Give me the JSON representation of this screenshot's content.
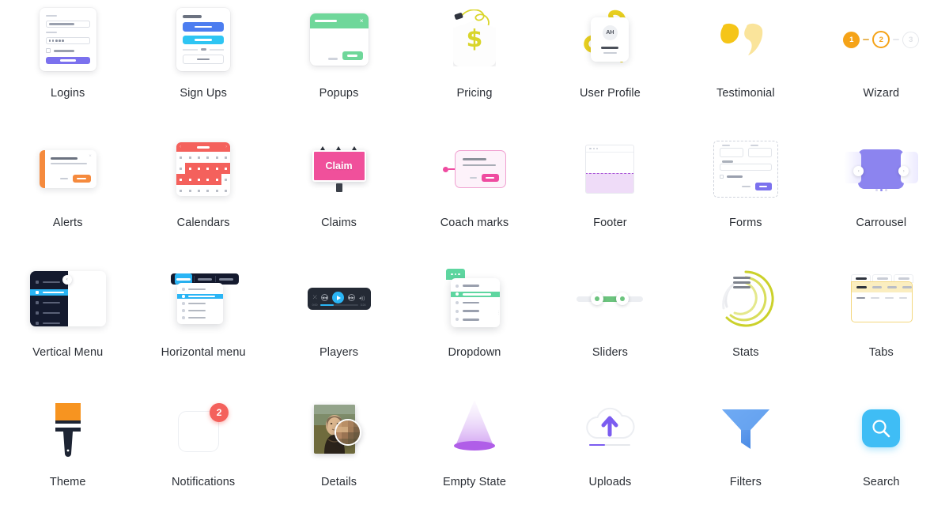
{
  "page": {
    "title": "UI Component Category Icon Grid",
    "columns": 7,
    "rows": 4
  },
  "items": [
    {
      "label": "Logins",
      "icon": "login-form-icon",
      "accent": "#7b71ee"
    },
    {
      "label": "Sign Ups",
      "icon": "signup-form-icon",
      "accent": "#4c7df0"
    },
    {
      "label": "Popups",
      "icon": "popup-modal-icon",
      "accent": "#6fd79a"
    },
    {
      "label": "Pricing",
      "icon": "price-tag-icon",
      "accent": "#d9d52a"
    },
    {
      "label": "User Profile",
      "icon": "profile-card-icon",
      "accent": "#e8cf1f"
    },
    {
      "label": "Testimonial",
      "icon": "quotation-marks-icon",
      "accent": "#f5c518"
    },
    {
      "label": "Wizard",
      "icon": "step-wizard-icon",
      "accent": "#f5a318"
    },
    {
      "label": "Alerts",
      "icon": "alert-banner-icon",
      "accent": "#f58a3d"
    },
    {
      "label": "Calendars",
      "icon": "calendar-icon",
      "accent": "#f4615c"
    },
    {
      "label": "Claims",
      "icon": "billboard-icon",
      "accent": "#f0509b"
    },
    {
      "label": "Coach marks",
      "icon": "coach-mark-tooltip-icon",
      "accent": "#ef4ba0"
    },
    {
      "label": "Footer",
      "icon": "page-footer-icon",
      "accent": "#a855d6"
    },
    {
      "label": "Forms",
      "icon": "form-fields-icon",
      "accent": "#7b71ee"
    },
    {
      "label": "Carrousel",
      "icon": "carousel-slider-icon",
      "accent": "#8c84ef"
    },
    {
      "label": "Vertical Menu",
      "icon": "vertical-menu-icon",
      "accent": "#2ab5f5"
    },
    {
      "label": "Horizontal menu",
      "icon": "horizontal-menu-icon",
      "accent": "#2ab5f5"
    },
    {
      "label": "Players",
      "icon": "media-player-icon",
      "accent": "#2ab5f5"
    },
    {
      "label": "Dropdown",
      "icon": "dropdown-list-icon",
      "accent": "#5ed6a0"
    },
    {
      "label": "Sliders",
      "icon": "range-slider-icon",
      "accent": "#6cc47e"
    },
    {
      "label": "Stats",
      "icon": "donut-chart-icon",
      "accent": "#cbd12a"
    },
    {
      "label": "Tabs",
      "icon": "tabbed-panel-icon",
      "accent": "#f3d77e"
    },
    {
      "label": "Theme",
      "icon": "paint-brush-icon",
      "accent": "#f79420"
    },
    {
      "label": "Notifications",
      "icon": "notification-badge-icon",
      "accent": "#f4615c"
    },
    {
      "label": "Details",
      "icon": "magnifier-artwork-icon",
      "accent": "#8a6a45"
    },
    {
      "label": "Empty State",
      "icon": "empty-spotlight-icon",
      "accent": "#b05ee8"
    },
    {
      "label": "Uploads",
      "icon": "cloud-upload-icon",
      "accent": "#7b5cf0"
    },
    {
      "label": "Filters",
      "icon": "funnel-filter-icon",
      "accent": "#4b8ef0"
    },
    {
      "label": "Search",
      "icon": "magnifying-glass-icon",
      "accent": "#3fbdf5"
    }
  ],
  "art_text": {
    "profile_initials": "AH",
    "wizard_steps": [
      "1",
      "2",
      "3"
    ],
    "claims_word": "Claim",
    "notifications_count": "2",
    "pricing_symbol": "$"
  }
}
